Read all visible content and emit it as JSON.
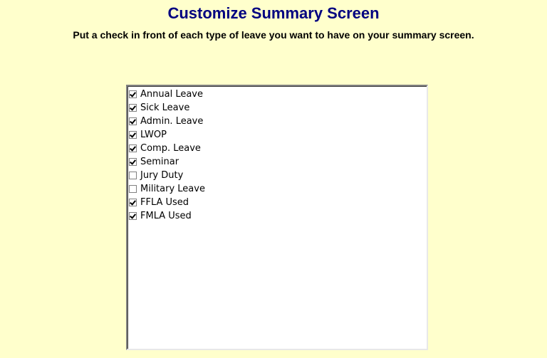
{
  "header": {
    "title": "Customize Summary Screen",
    "instructions": "Put a check in front of each type of leave you want to have on your summary screen."
  },
  "colors": {
    "background": "#ffffcc",
    "title": "#000080"
  },
  "leave_list": {
    "items": [
      {
        "label": "Annual Leave",
        "checked": true
      },
      {
        "label": "Sick Leave",
        "checked": true
      },
      {
        "label": "Admin. Leave",
        "checked": true
      },
      {
        "label": "LWOP",
        "checked": true
      },
      {
        "label": "Comp. Leave",
        "checked": true
      },
      {
        "label": "Seminar",
        "checked": true
      },
      {
        "label": "Jury Duty",
        "checked": false
      },
      {
        "label": "Military Leave",
        "checked": false
      },
      {
        "label": "FFLA Used",
        "checked": true
      },
      {
        "label": "FMLA Used",
        "checked": true
      }
    ]
  }
}
